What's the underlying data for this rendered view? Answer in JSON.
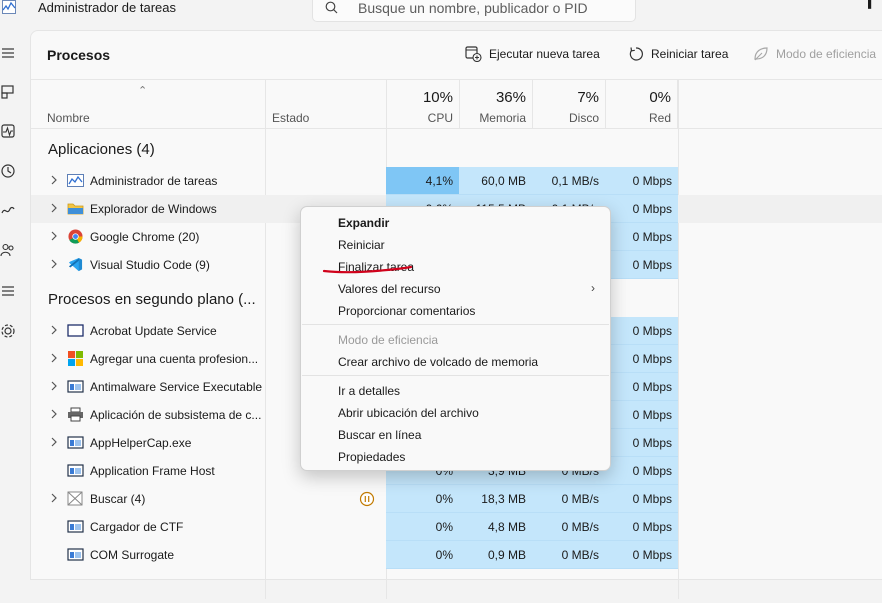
{
  "window": {
    "title": "Administrador de tareas"
  },
  "search": {
    "placeholder": "Busque un nombre, publicador o PID"
  },
  "nav": [
    {
      "icon": "hamburger-menu-icon"
    },
    {
      "icon": "processes-icon"
    },
    {
      "icon": "performance-icon"
    },
    {
      "icon": "app-history-icon"
    },
    {
      "icon": "startup-apps-icon"
    },
    {
      "icon": "users-icon"
    },
    {
      "icon": "details-icon"
    },
    {
      "icon": "services-icon"
    }
  ],
  "page": {
    "title": "Procesos"
  },
  "commands": {
    "new_task": "Ejecutar nueva tarea",
    "restart_task": "Reiniciar tarea",
    "efficiency_mode": "Modo de eficiencia"
  },
  "columns": {
    "name": "Nombre",
    "state": "Estado",
    "cpu": {
      "percent": "10%",
      "label": "CPU"
    },
    "memory": {
      "percent": "36%",
      "label": "Memoria"
    },
    "disk": {
      "percent": "7%",
      "label": "Disco"
    },
    "network": {
      "percent": "0%",
      "label": "Red"
    }
  },
  "sections": {
    "apps": "Aplicaciones (4)",
    "background": "Procesos en segundo plano (..."
  },
  "apps": [
    {
      "name": "Administrador de tareas",
      "icon": "task-manager-icon",
      "cpu": "4,1%",
      "memory": "60,0 MB",
      "disk": "0,1 MB/s",
      "network": "0 Mbps"
    },
    {
      "name": "Explorador de Windows",
      "icon": "folder-icon",
      "cpu": "0,6%",
      "memory": "115,5 MB",
      "disk": "0,1 MB/s",
      "network": "0 Mbps"
    },
    {
      "name": "Google Chrome (20)",
      "icon": "chrome-icon",
      "network": "0 Mbps"
    },
    {
      "name": "Visual Studio Code (9)",
      "icon": "vscode-icon",
      "network": "0 Mbps"
    }
  ],
  "background": [
    {
      "name": "Acrobat Update Service",
      "icon": "window-icon",
      "network": "0 Mbps"
    },
    {
      "name": "Agregar una cuenta profesion...",
      "icon": "windows-logo-icon",
      "network": "0 Mbps"
    },
    {
      "name": "Antimalware Service Executable",
      "icon": "service-window-icon",
      "network": "0 Mbps"
    },
    {
      "name": "Aplicación de subsistema de c...",
      "icon": "printer-icon",
      "network": "0 Mbps"
    },
    {
      "name": "AppHelperCap.exe",
      "icon": "service-window-icon",
      "network": "0 Mbps"
    },
    {
      "name": "Application Frame Host",
      "icon": "service-window-icon",
      "cpu": "0%",
      "memory": "3,9 MB",
      "disk": "0 MB/s",
      "network": "0 Mbps"
    },
    {
      "name": "Buscar (4)",
      "icon": "search-app-icon",
      "cpu": "0%",
      "memory": "18,3 MB",
      "disk": "0 MB/s",
      "network": "0 Mbps"
    },
    {
      "name": "Cargador de CTF",
      "icon": "service-window-icon",
      "cpu": "0%",
      "memory": "4,8 MB",
      "disk": "0 MB/s",
      "network": "0 Mbps"
    },
    {
      "name": "COM Surrogate",
      "icon": "service-window-icon",
      "cpu": "0%",
      "memory": "0,9 MB",
      "disk": "0 MB/s",
      "network": "0 Mbps"
    }
  ],
  "context_menu": {
    "expand": "Expandir",
    "restart": "Reiniciar",
    "end_task": "Finalizar tarea",
    "resource_values": "Valores del recurso",
    "feedback": "Proporcionar comentarios",
    "efficiency": "Modo de eficiencia",
    "dump": "Crear archivo de volcado de memoria",
    "details": "Ir a detalles",
    "open_location": "Abrir ubicación del archivo",
    "search_online": "Buscar en línea",
    "properties": "Propiedades"
  },
  "colors": {
    "heat_low": "#c4e6fb",
    "heat_high": "#7fc6f5",
    "annotation": "#d0021b"
  }
}
